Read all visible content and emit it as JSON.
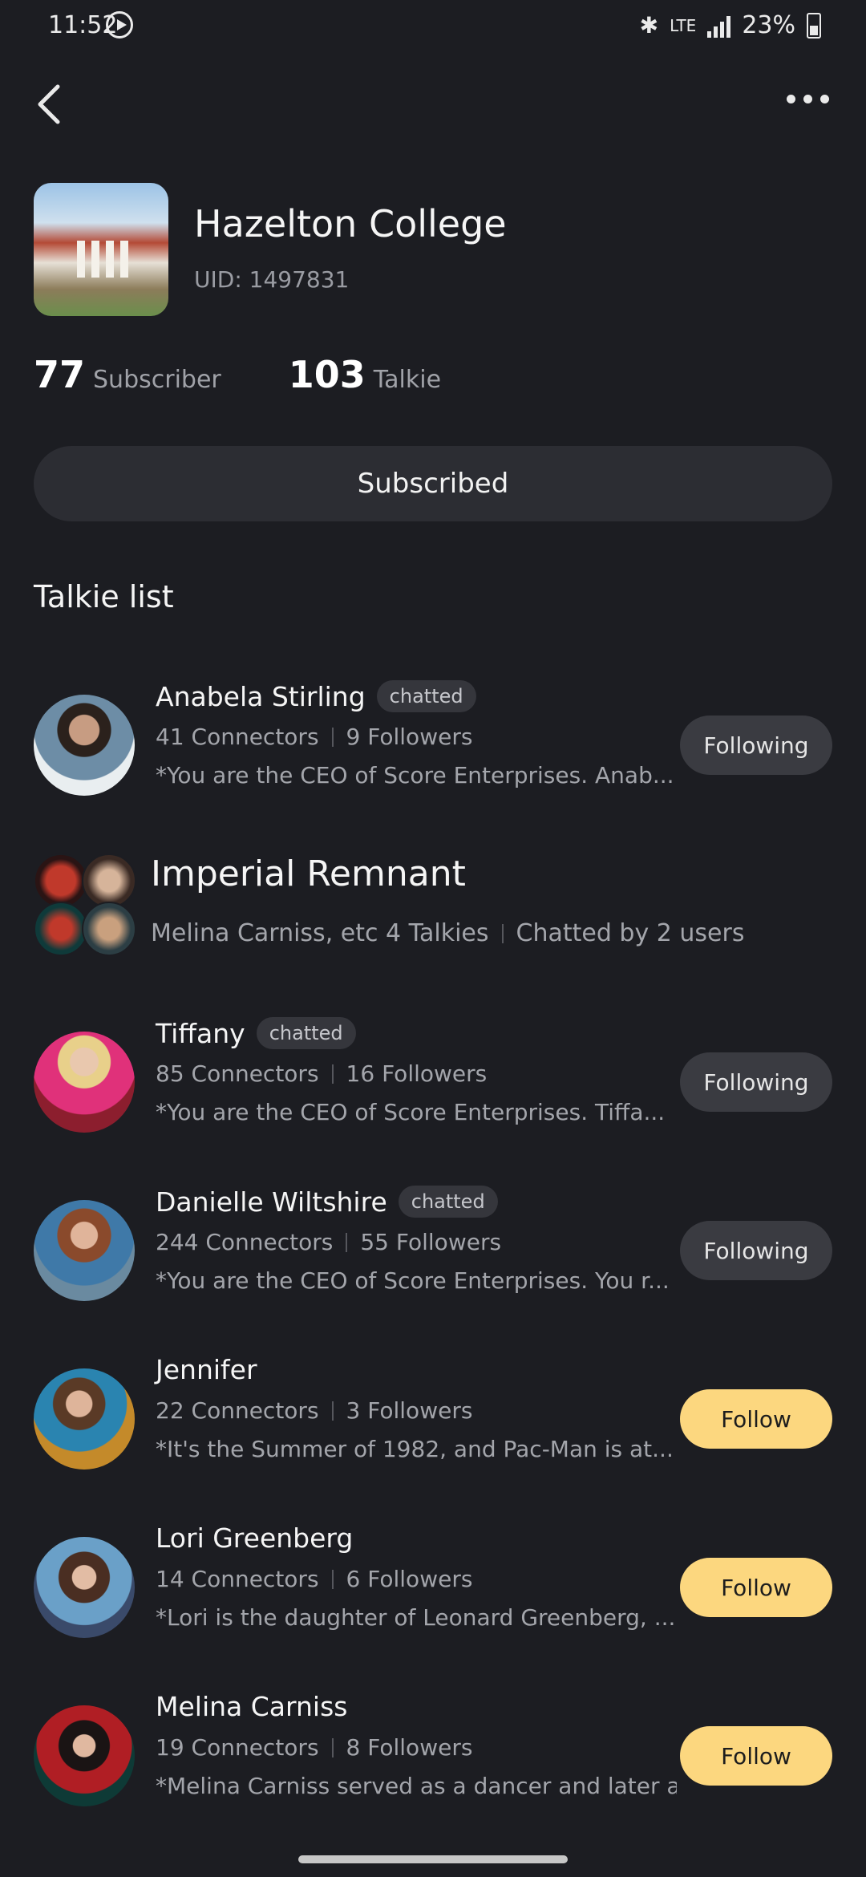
{
  "status_bar": {
    "time": "11:52",
    "lte": "LTE",
    "battery": "23%"
  },
  "header": {
    "title": "Hazelton College",
    "uid": "UID: 1497831",
    "subscriber_count": "77",
    "subscriber_label": "Subscriber",
    "talkie_count": "103",
    "talkie_label": "Talkie",
    "subscribed_label": "Subscribed"
  },
  "section_title": "Talkie list",
  "list": [
    {
      "name": "Anabela Stirling",
      "badge": "chatted",
      "connectors": "41 Connectors",
      "followers": "9 Followers",
      "desc": "*You are the CEO of Score Enterprises.  Anab...",
      "button": "Following"
    },
    {
      "name": "Tiffany",
      "badge": "chatted",
      "connectors": "85 Connectors",
      "followers": "16 Followers",
      "desc": "*You are the CEO of Score Enterprises.  Tiffa...",
      "button": "Following"
    },
    {
      "name": "Danielle Wiltshire",
      "badge": "chatted",
      "connectors": "244 Connectors",
      "followers": "55 Followers",
      "desc": "*You are the CEO of Score Enterprises.  You r...",
      "button": "Following"
    },
    {
      "name": "Jennifer",
      "connectors": "22 Connectors",
      "followers": "3 Followers",
      "desc": "*It's the Summer of 1982, and Pac-Man is at...",
      "button": "Follow"
    },
    {
      "name": "Lori Greenberg",
      "connectors": "14 Connectors",
      "followers": "6 Followers",
      "desc": "*Lori is the daughter of Leonard Greenberg, ...",
      "button": "Follow"
    },
    {
      "name": "Melina Carniss",
      "connectors": "19 Connectors",
      "followers": "8 Followers",
      "desc": "*Melina Carniss served as a dancer and later a...",
      "button": "Follow"
    }
  ],
  "group": {
    "title": "Imperial Remnant",
    "members": "Melina Carniss, etc 4 Talkies",
    "chatted": "Chatted by 2 users"
  },
  "colors": {
    "background": "#1c1d22",
    "follow_accent": "#fcd77f",
    "following_bg": "#3a3b41"
  }
}
